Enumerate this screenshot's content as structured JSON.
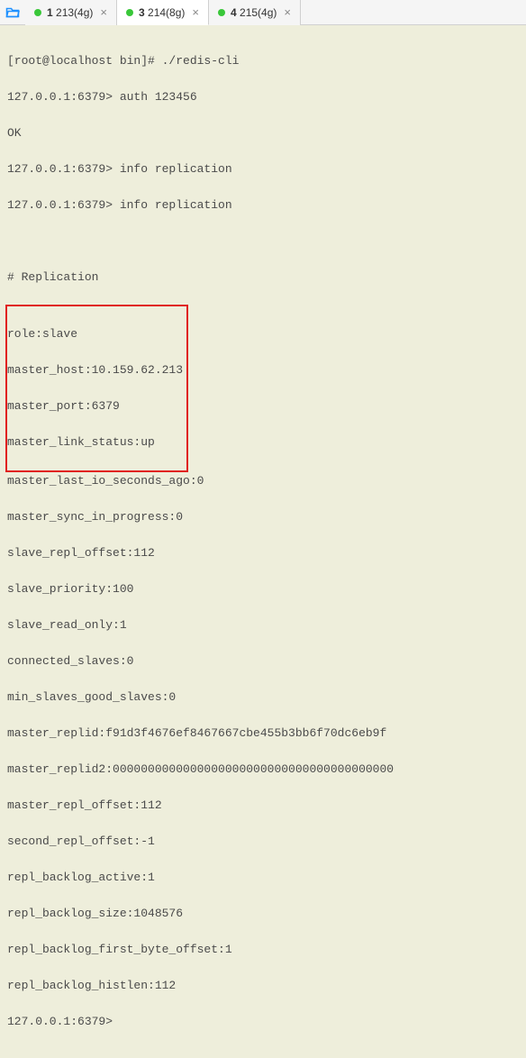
{
  "tabs": [
    {
      "label_num": "1",
      "label_text": "213(4g)"
    },
    {
      "label_num": "3",
      "label_text": "214(8g)"
    },
    {
      "label_num": "4",
      "label_text": "215(4g)"
    }
  ],
  "term": {
    "line1": "[root@localhost bin]# ./redis-cli",
    "line2": "127.0.0.1:6379> auth 123456",
    "line3": "OK",
    "line4": "127.0.0.1:6379> info replication",
    "line5": "127.0.0.1:6379> info replication",
    "blank": "",
    "section": "# Replication",
    "hl1": "role:slave",
    "hl2": "master_host:10.159.62.213",
    "hl3": "master_port:6379",
    "hl4": "master_link_status:up",
    "r1": "master_last_io_seconds_ago:0",
    "r2": "master_sync_in_progress:0",
    "r3": "slave_repl_offset:112",
    "r4": "slave_priority:100",
    "r5": "slave_read_only:1",
    "r6": "connected_slaves:0",
    "r7": "min_slaves_good_slaves:0",
    "r8": "master_replid:f91d3f4676ef8467667cbe455b3bb6f70dc6eb9f",
    "r9": "master_replid2:0000000000000000000000000000000000000000",
    "r10": "master_repl_offset:112",
    "r11": "second_repl_offset:-1",
    "r12": "repl_backlog_active:1",
    "r13": "repl_backlog_size:1048576",
    "r14": "repl_backlog_first_byte_offset:1",
    "r15": "repl_backlog_histlen:112",
    "prompt": "127.0.0.1:6379>"
  }
}
